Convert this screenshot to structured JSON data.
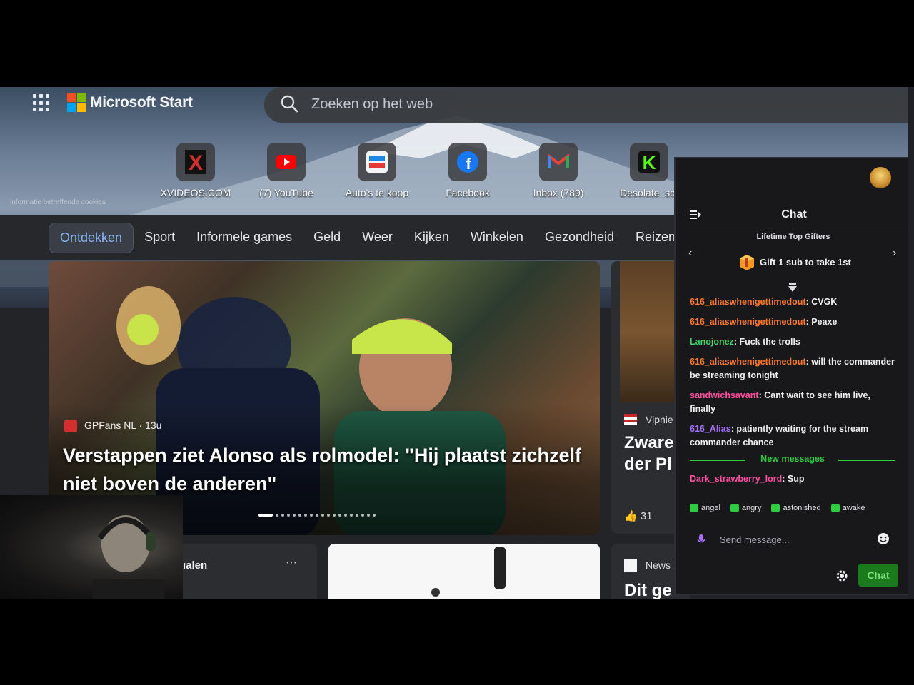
{
  "header": {
    "brand": "Microsoft Start",
    "search_placeholder": "Zoeken op het web"
  },
  "cookie_notice": "informatie betreffende cookies",
  "quick_links": [
    {
      "label": "XVIDEOS.COM",
      "icon": "x-logo-icon",
      "color": "#d32f2f"
    },
    {
      "label": "(7) YouTube",
      "icon": "youtube-icon",
      "color": "#ff0000"
    },
    {
      "label": "Auto's te koop",
      "icon": "car-listing-icon",
      "color": "#1e88e5"
    },
    {
      "label": "Facebook",
      "icon": "facebook-icon",
      "color": "#1877f2"
    },
    {
      "label": "Inbox (789)",
      "icon": "gmail-icon",
      "color": "#ea4335"
    },
    {
      "label": "Desolate_scr",
      "icon": "kick-icon",
      "color": "#53fc18"
    }
  ],
  "nav_tabs": [
    "Ontdekken",
    "Sport",
    "Informele games",
    "Geld",
    "Weer",
    "Kijken",
    "Winkelen",
    "Gezondheid",
    "Reizen"
  ],
  "main_story": {
    "source": "GPFans NL · 13u",
    "headline": "Verstappen ziet Alonso als rolmodel: \"Hij plaatst zichzelf niet boven de anderen\""
  },
  "side_story": {
    "source": "Vipnie",
    "headline": "Zware der Pl",
    "likes": "31"
  },
  "bottom_cards": {
    "card1_title": "ıalen",
    "card1_more": "···",
    "card3_source": "News",
    "card3_headline": "Dit ge"
  },
  "chat": {
    "title": "Chat",
    "gifters_label": "Lifetime Top Gifters",
    "gift_text": "Gift 1 sub to take 1st",
    "messages": [
      {
        "user": "616_aliaswhenigettimedout",
        "color": "#ff7a2e",
        "text": ": CVGK"
      },
      {
        "user": "616_aliaswhenigettimedout",
        "color": "#ff7a2e",
        "text": ": Peaxe"
      },
      {
        "user": "Lanojonez",
        "color": "#3fd46a",
        "text": ": Fuck the trolls"
      },
      {
        "user": "616_aliaswhenigettimedout",
        "color": "#ff7a2e",
        "text": ": will the commander be streaming tonight"
      },
      {
        "user": "sandwichsavant",
        "color": "#ff4fa3",
        "text": ": Cant wait to see him live, finally"
      },
      {
        "user": "616_Alias",
        "color": "#a970ff",
        "text": ": patiently waiting for the stream commander chance"
      }
    ],
    "new_messages_label": "New messages",
    "last_message": {
      "user": "Dark_strawberry_lord",
      "color": "#ff4fa3",
      "text": ": Sup"
    },
    "emotes": [
      "angel",
      "angry",
      "astonished",
      "awake"
    ],
    "input_placeholder": "Send message...",
    "send_label": "Chat"
  },
  "colors": {
    "accent_tab": "#8ab4f8",
    "chat_bg": "#18181b",
    "chat_button": "#1b7a1b"
  }
}
